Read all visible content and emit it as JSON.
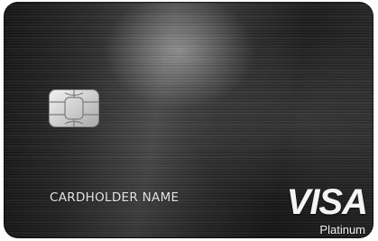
{
  "card": {
    "cardholder_name": "CARDHOLDER NAME",
    "network": "VISA",
    "tier": "Platinum",
    "chip_icon": "emv-chip-icon",
    "colors": {
      "card_base": "#2a2a2a",
      "text": "#e6e6e6",
      "chip": "#d8d8d8"
    }
  }
}
